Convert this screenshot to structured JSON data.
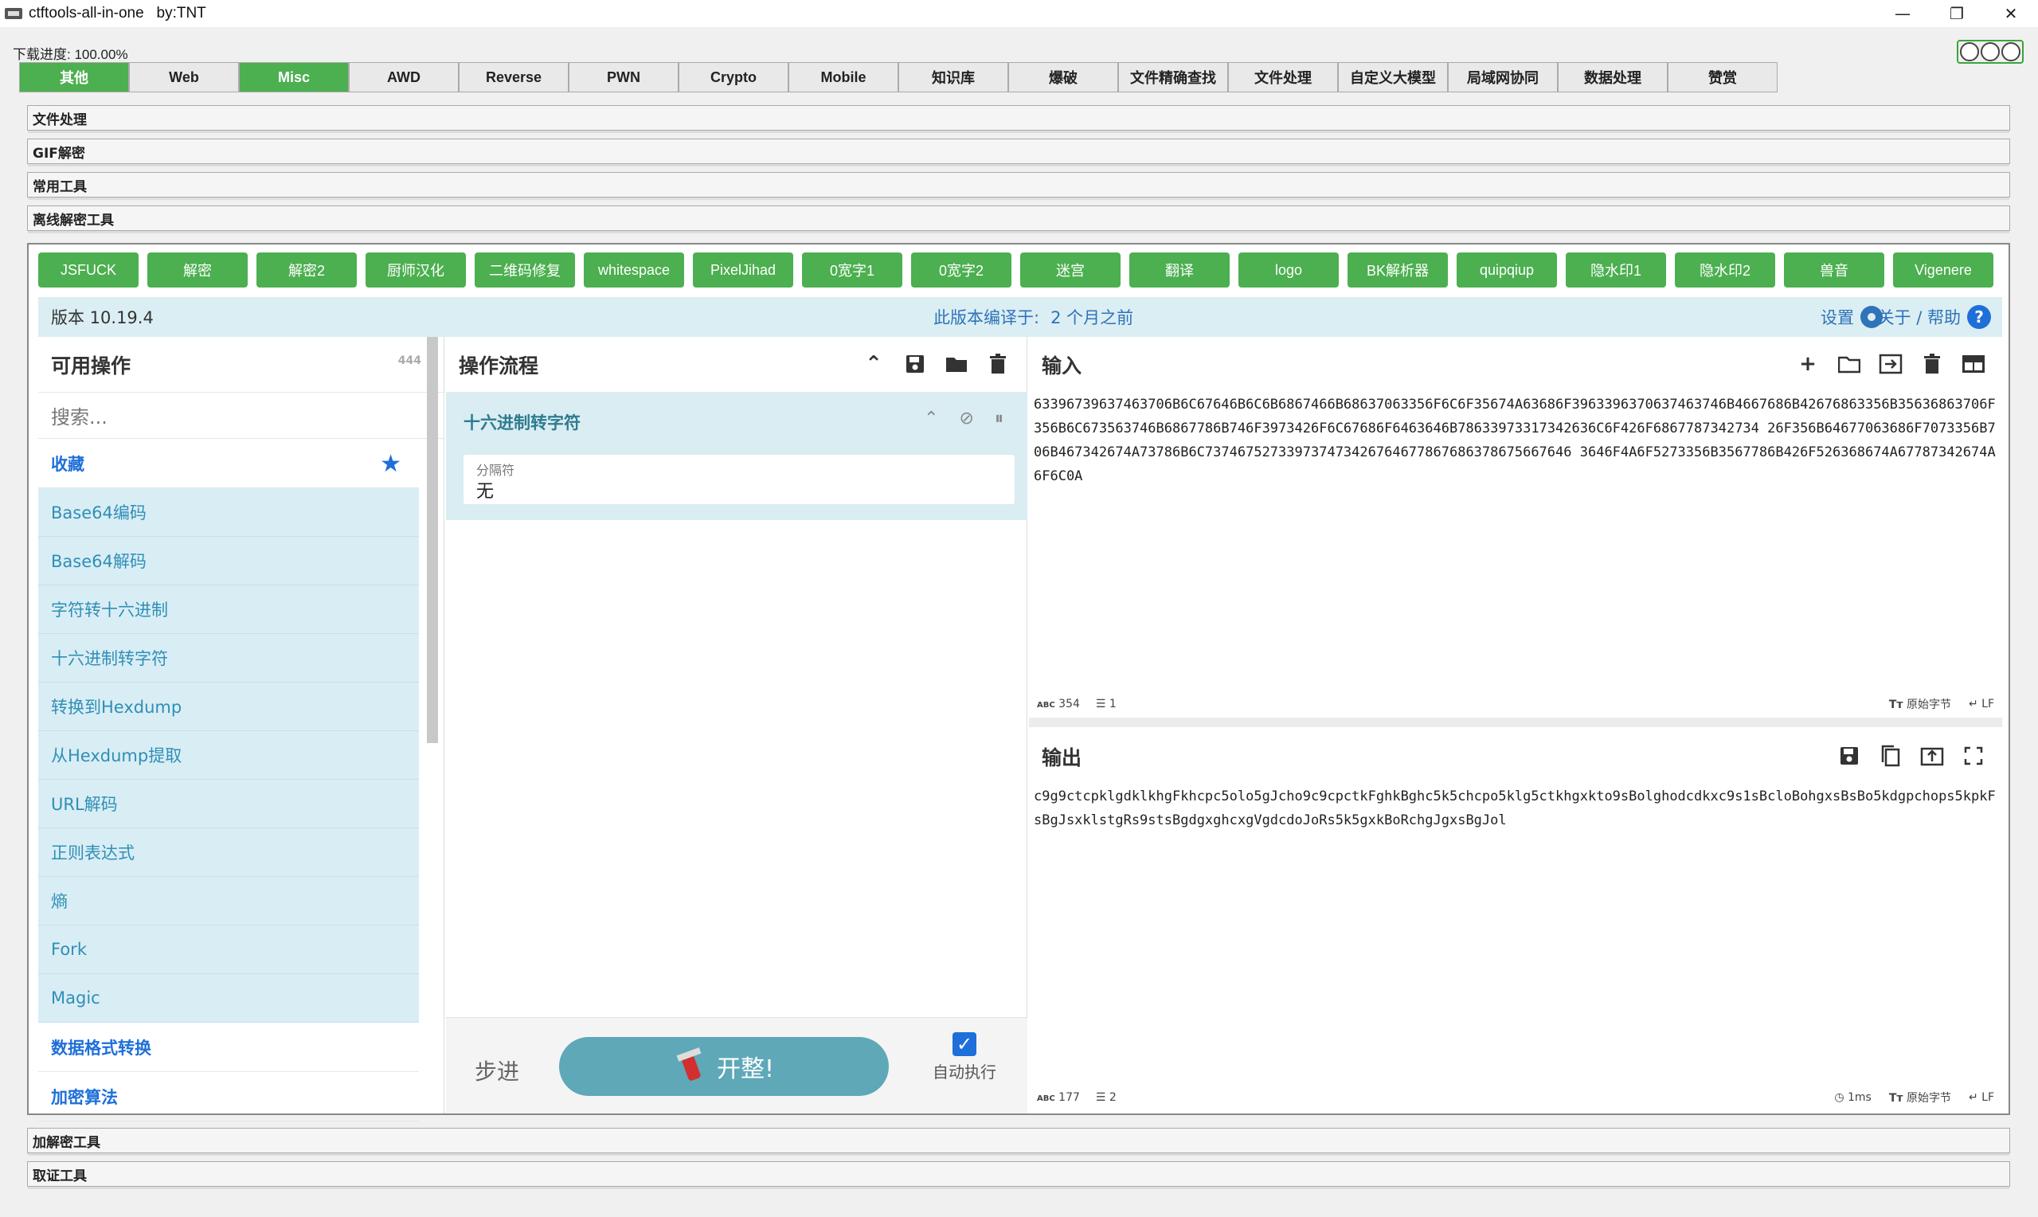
{
  "window": {
    "title": "ctftools-all-in-one   by:TNT",
    "minimize": "—",
    "restore": "❐",
    "close": "✕"
  },
  "progress": {
    "label": "下载进度: 100.00%",
    "value": 100
  },
  "top_tabs": [
    "其他",
    "Web",
    "Misc",
    "AWD",
    "Reverse",
    "PWN",
    "Crypto",
    "Mobile",
    "知识库",
    "爆破",
    "文件精确查找",
    "文件处理",
    "自定义大模型",
    "局域网协同",
    "数据处理",
    "赞赏"
  ],
  "top_tabs_active": [
    "其他",
    "Misc"
  ],
  "sections": {
    "file_processing": "文件处理",
    "gif_decrypt": "GIF解密",
    "common_tools": "常用工具",
    "offline_decrypt": "离线解密工具",
    "encrypt_tools": "加解密工具",
    "forensics": "取证工具"
  },
  "toolbar_buttons": [
    "JSFUCK",
    "解密",
    "解密2",
    "厨师汉化",
    "二维码修复",
    "whitespace",
    "PixelJihad",
    "0宽字1",
    "0宽字2",
    "迷宫",
    "翻译",
    "logo",
    "BK解析器",
    "quipqiup",
    "隐水印1",
    "隐水印2",
    "兽音",
    "Vigenere"
  ],
  "status": {
    "version": "版本 10.19.4",
    "compiled_label": "此版本编译于:",
    "compiled_ago": "2 个月之前",
    "settings": "设置",
    "about": "关于 / 帮助",
    "help_icon": "?"
  },
  "operations": {
    "title": "可用操作",
    "count": "444",
    "search_placeholder": "搜索...",
    "favorites": "收藏",
    "items": [
      "Base64编码",
      "Base64解码",
      "字符转十六进制",
      "十六进制转字符",
      "转换到Hexdump",
      "从Hexdump提取",
      "URL解码",
      "正则表达式",
      "熵",
      "Fork",
      "Magic"
    ],
    "category_data_format": "数据格式转换",
    "category_encryption": "加密算法"
  },
  "recipe": {
    "title": "操作流程",
    "step_name": "十六进制转字符",
    "field_label": "分隔符",
    "field_value": "无",
    "step_button": "步进",
    "bake_button": "开整!",
    "auto_bake_label": "自动执行",
    "auto_bake_checked": true
  },
  "input": {
    "title": "输入",
    "text": "63396739637463706B6C67646B6C6B6867466B68637063356F6C6F35674A63686F3963396370637463746B4667686B42676863356B35636863706F356B6C673563746B6867786B746F3973426F6C67686F6463646B78633973317342636C6F426F6867787342734 26F356B64677063686F7073356B706B467342674A73786B6C737467527339737473426764677867686378675667646 3646F4A6F5273356B3567786B426F526368674A67787342674A6F6C0A",
    "chars": "354",
    "lines": "1",
    "encoding": "原始字节",
    "eol": "LF"
  },
  "output": {
    "title": "输出",
    "text": "c9g9ctcpklgdklkhgFkhcpc5olo5gJcho9c9cpctkFghkBghc5k5chcpo5klg5ctkhgxkto9sBolghodcdkxc9s1sBcloBohgxsBsBo5kdgpchops5kpkFsBgJsxklstgRs9stsBgdgxghcxgVgdcdoJoRs5k5gxkBoRchgJgxsBgJol",
    "chars": "177",
    "lines": "2",
    "time": "1ms",
    "encoding": "原始字节",
    "eol": "LF"
  },
  "colors": {
    "tab_active": "#4caf50",
    "toolbar_button": "#4caf50",
    "accent_blue": "#1e6fd9",
    "op_bg": "#d9edf5",
    "bake_button": "#5ea8b8"
  }
}
